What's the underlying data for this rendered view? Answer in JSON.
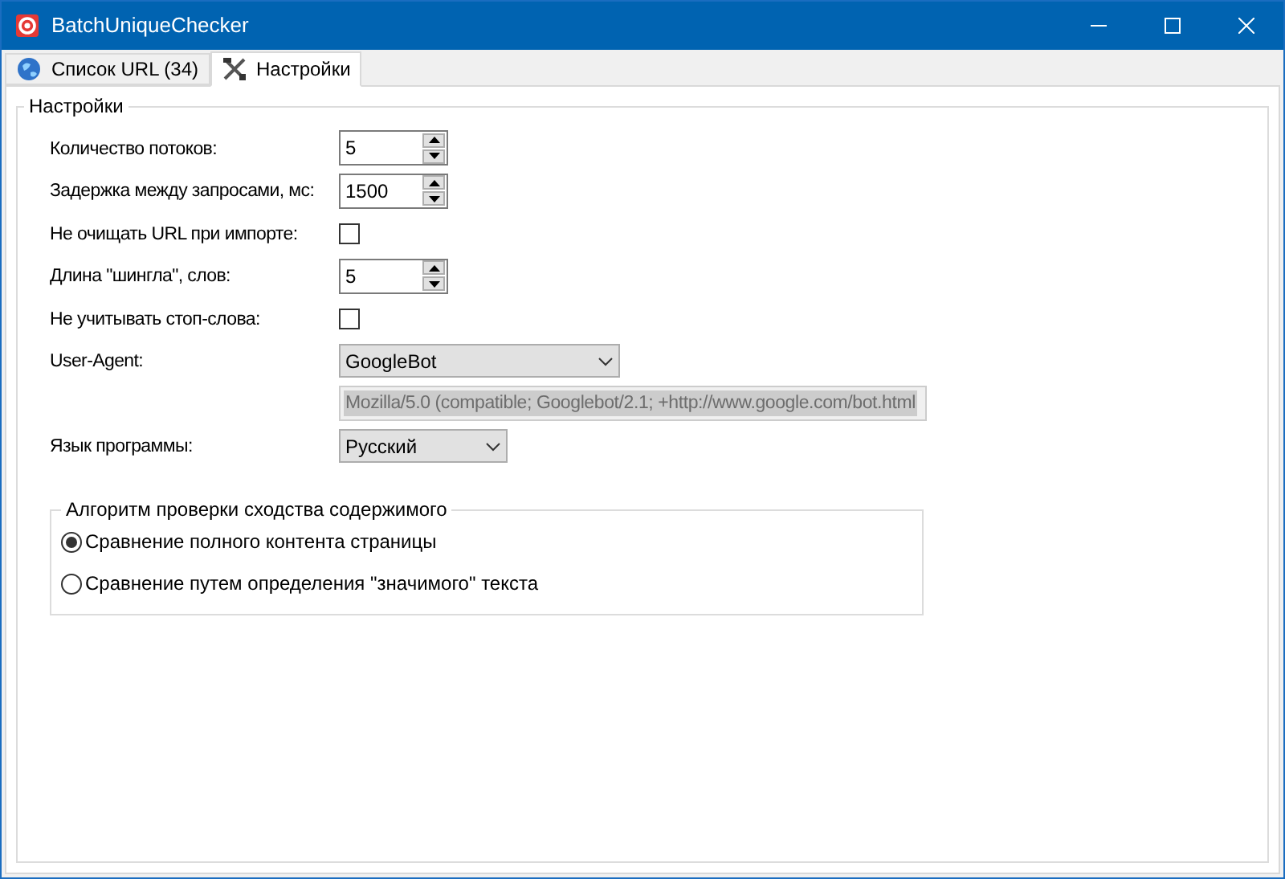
{
  "window": {
    "title": "BatchUniqueChecker"
  },
  "tabs": [
    {
      "label": "Список URL (34)",
      "selected": false
    },
    {
      "label": "Настройки",
      "selected": true
    }
  ],
  "settings": {
    "title": "Настройки",
    "rows": [
      {
        "kind": "spin",
        "label": "Количество потоков:",
        "value": "5"
      },
      {
        "kind": "spin",
        "label": "Задержка между запросами, мс:",
        "value": "1500"
      },
      {
        "kind": "checkbox",
        "label": "Не очищать URL при импорте:",
        "checked": false
      },
      {
        "kind": "spin",
        "label": "Длина \"шингла\", слов:",
        "value": "5"
      },
      {
        "kind": "checkbox",
        "label": "Не учитывать стоп-слова:",
        "checked": false
      },
      {
        "kind": "combo",
        "label": "User-Agent:",
        "value": "GoogleBot",
        "wide": true
      },
      {
        "kind": "readonly",
        "value": "Mozilla/5.0 (compatible; Googlebot/2.1; +http://www.google.com/bot.html"
      },
      {
        "kind": "combo",
        "label": "Язык программы:",
        "value": "Русский",
        "wide": false
      }
    ],
    "algorithm": {
      "title": "Алгоритм проверки сходства содержимого",
      "options": [
        {
          "label": "Сравнение полного контента страницы",
          "selected": true
        },
        {
          "label": "Сравнение путем определения \"значимого\" текста",
          "selected": false
        }
      ]
    }
  }
}
